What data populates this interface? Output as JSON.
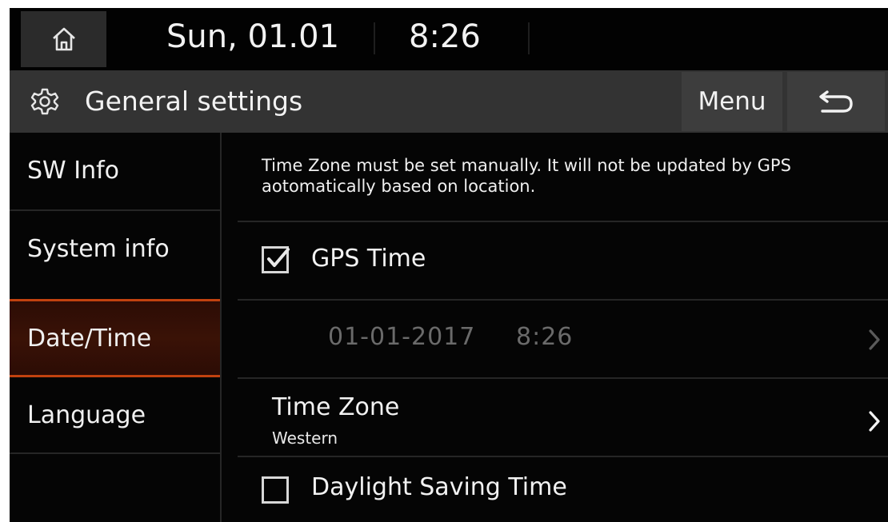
{
  "status_bar": {
    "date": "Sun, 01.01",
    "time": "8:26"
  },
  "title_bar": {
    "title": "General settings",
    "menu_label": "Menu"
  },
  "sidebar": {
    "items": [
      {
        "label": "SW Info",
        "active": false
      },
      {
        "label": "System info",
        "active": false
      },
      {
        "label": "Date/Time",
        "active": true
      },
      {
        "label": "Language",
        "active": false
      }
    ]
  },
  "content": {
    "notice": "Time Zone must be set manually. It will not be updated by GPS aotomatically based on location.",
    "gps_time": {
      "label": "GPS Time",
      "checked": true
    },
    "date_time": {
      "date": "01-01-2017",
      "time": "8:26"
    },
    "time_zone": {
      "label": "Time Zone",
      "value": "Western"
    },
    "daylight_saving": {
      "label": "Daylight Saving Time",
      "checked": false
    }
  },
  "colors": {
    "accent": "#c2420f",
    "active_bg": "#3a1206",
    "title_bar_bg": "#333333",
    "button_bg": "#3d3d3d",
    "disabled_text": "#6a6a6a"
  },
  "icons": {
    "home": "home-icon",
    "settings": "gear-icon",
    "back": "back-arrow-icon",
    "chevron": "chevron-right-icon",
    "checkbox_checked": "checkbox-checked-icon",
    "checkbox_unchecked": "checkbox-unchecked-icon"
  }
}
